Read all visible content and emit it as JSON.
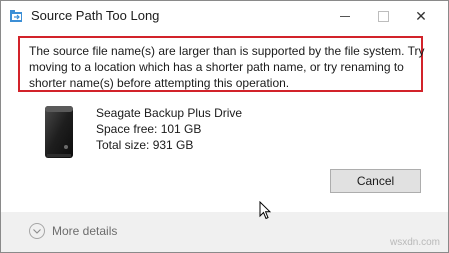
{
  "window": {
    "title": "Source Path Too Long",
    "app_icon": "explorer-copy-icon",
    "controls": {
      "minimize": "minimize-icon",
      "maximize": "maximize-icon",
      "close_glyph": "✕"
    }
  },
  "message": {
    "lines": [
      "The source file name(s) are larger than is supported by the file system. Try",
      "moving to a location which has a shorter path name, or try renaming to",
      "shorter name(s) before attempting this operation."
    ],
    "highlight_color": "#d2232a"
  },
  "drive": {
    "icon": "external-hard-drive-icon",
    "name": "Seagate Backup Plus Drive",
    "space_free": "Space free: 101 GB",
    "total_size": "Total size: 931 GB"
  },
  "buttons": {
    "cancel": "Cancel"
  },
  "footer": {
    "details_label": "More details",
    "details_icon": "chevron-down-icon"
  },
  "watermark": "wsxdn.com"
}
